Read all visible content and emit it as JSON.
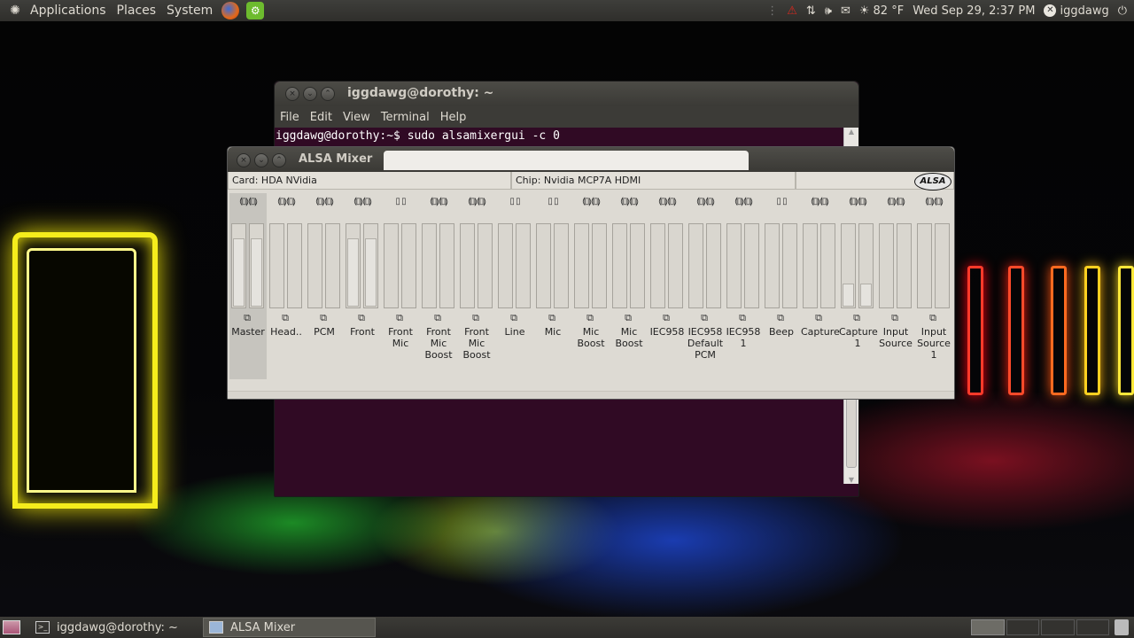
{
  "top_panel": {
    "menus": [
      "Applications",
      "Places",
      "System"
    ],
    "weather": "82 °F",
    "clock": "Wed Sep 29,  2:37 PM",
    "user": "iggdawg"
  },
  "terminal": {
    "title": "iggdawg@dorothy: ~",
    "menu": [
      "File",
      "Edit",
      "View",
      "Terminal",
      "Help"
    ],
    "prompt_line": "iggdawg@dorothy:~$ sudo alsamixergui -c 0"
  },
  "mixer": {
    "title": "ALSA Mixer",
    "card": "Card: HDA NVidia",
    "chip": "Chip: Nvidia MCP7A HDMI",
    "logo": "ALSA",
    "channels": [
      {
        "label": "Master",
        "stereo": true,
        "level": 0.82,
        "selected": true
      },
      {
        "label": "Head..",
        "stereo": true,
        "level": 0.0
      },
      {
        "label": "PCM",
        "stereo": true,
        "level": 0.0
      },
      {
        "label": "Front",
        "stereo": true,
        "level": 0.82
      },
      {
        "label": "Front Mic",
        "stereo": false,
        "level": 0.0
      },
      {
        "label": "Front Mic Boost",
        "stereo": true,
        "level": 0.0
      },
      {
        "label": "Front Mic Boost",
        "stereo": true,
        "level": 0.0
      },
      {
        "label": "Line",
        "stereo": false,
        "level": 0.0
      },
      {
        "label": "Mic",
        "stereo": false,
        "level": 0.0
      },
      {
        "label": "Mic Boost",
        "stereo": true,
        "level": 0.0
      },
      {
        "label": "Mic Boost",
        "stereo": true,
        "level": 0.0
      },
      {
        "label": "IEC958",
        "stereo": true,
        "level": 0.0
      },
      {
        "label": "IEC958 Default PCM",
        "stereo": true,
        "level": 0.0
      },
      {
        "label": "IEC958 1",
        "stereo": true,
        "level": 0.0
      },
      {
        "label": "Beep",
        "stereo": false,
        "level": 0.0
      },
      {
        "label": "Capture",
        "stereo": true,
        "level": 0.0
      },
      {
        "label": "Capture 1",
        "stereo": true,
        "level": 0.28
      },
      {
        "label": "Input Source",
        "stereo": true,
        "level": 0.0
      },
      {
        "label": "Input Source 1",
        "stereo": true,
        "level": 0.0
      }
    ]
  },
  "taskbar": {
    "tasks": [
      "iggdawg@dorothy: ~",
      "ALSA Mixer"
    ]
  }
}
